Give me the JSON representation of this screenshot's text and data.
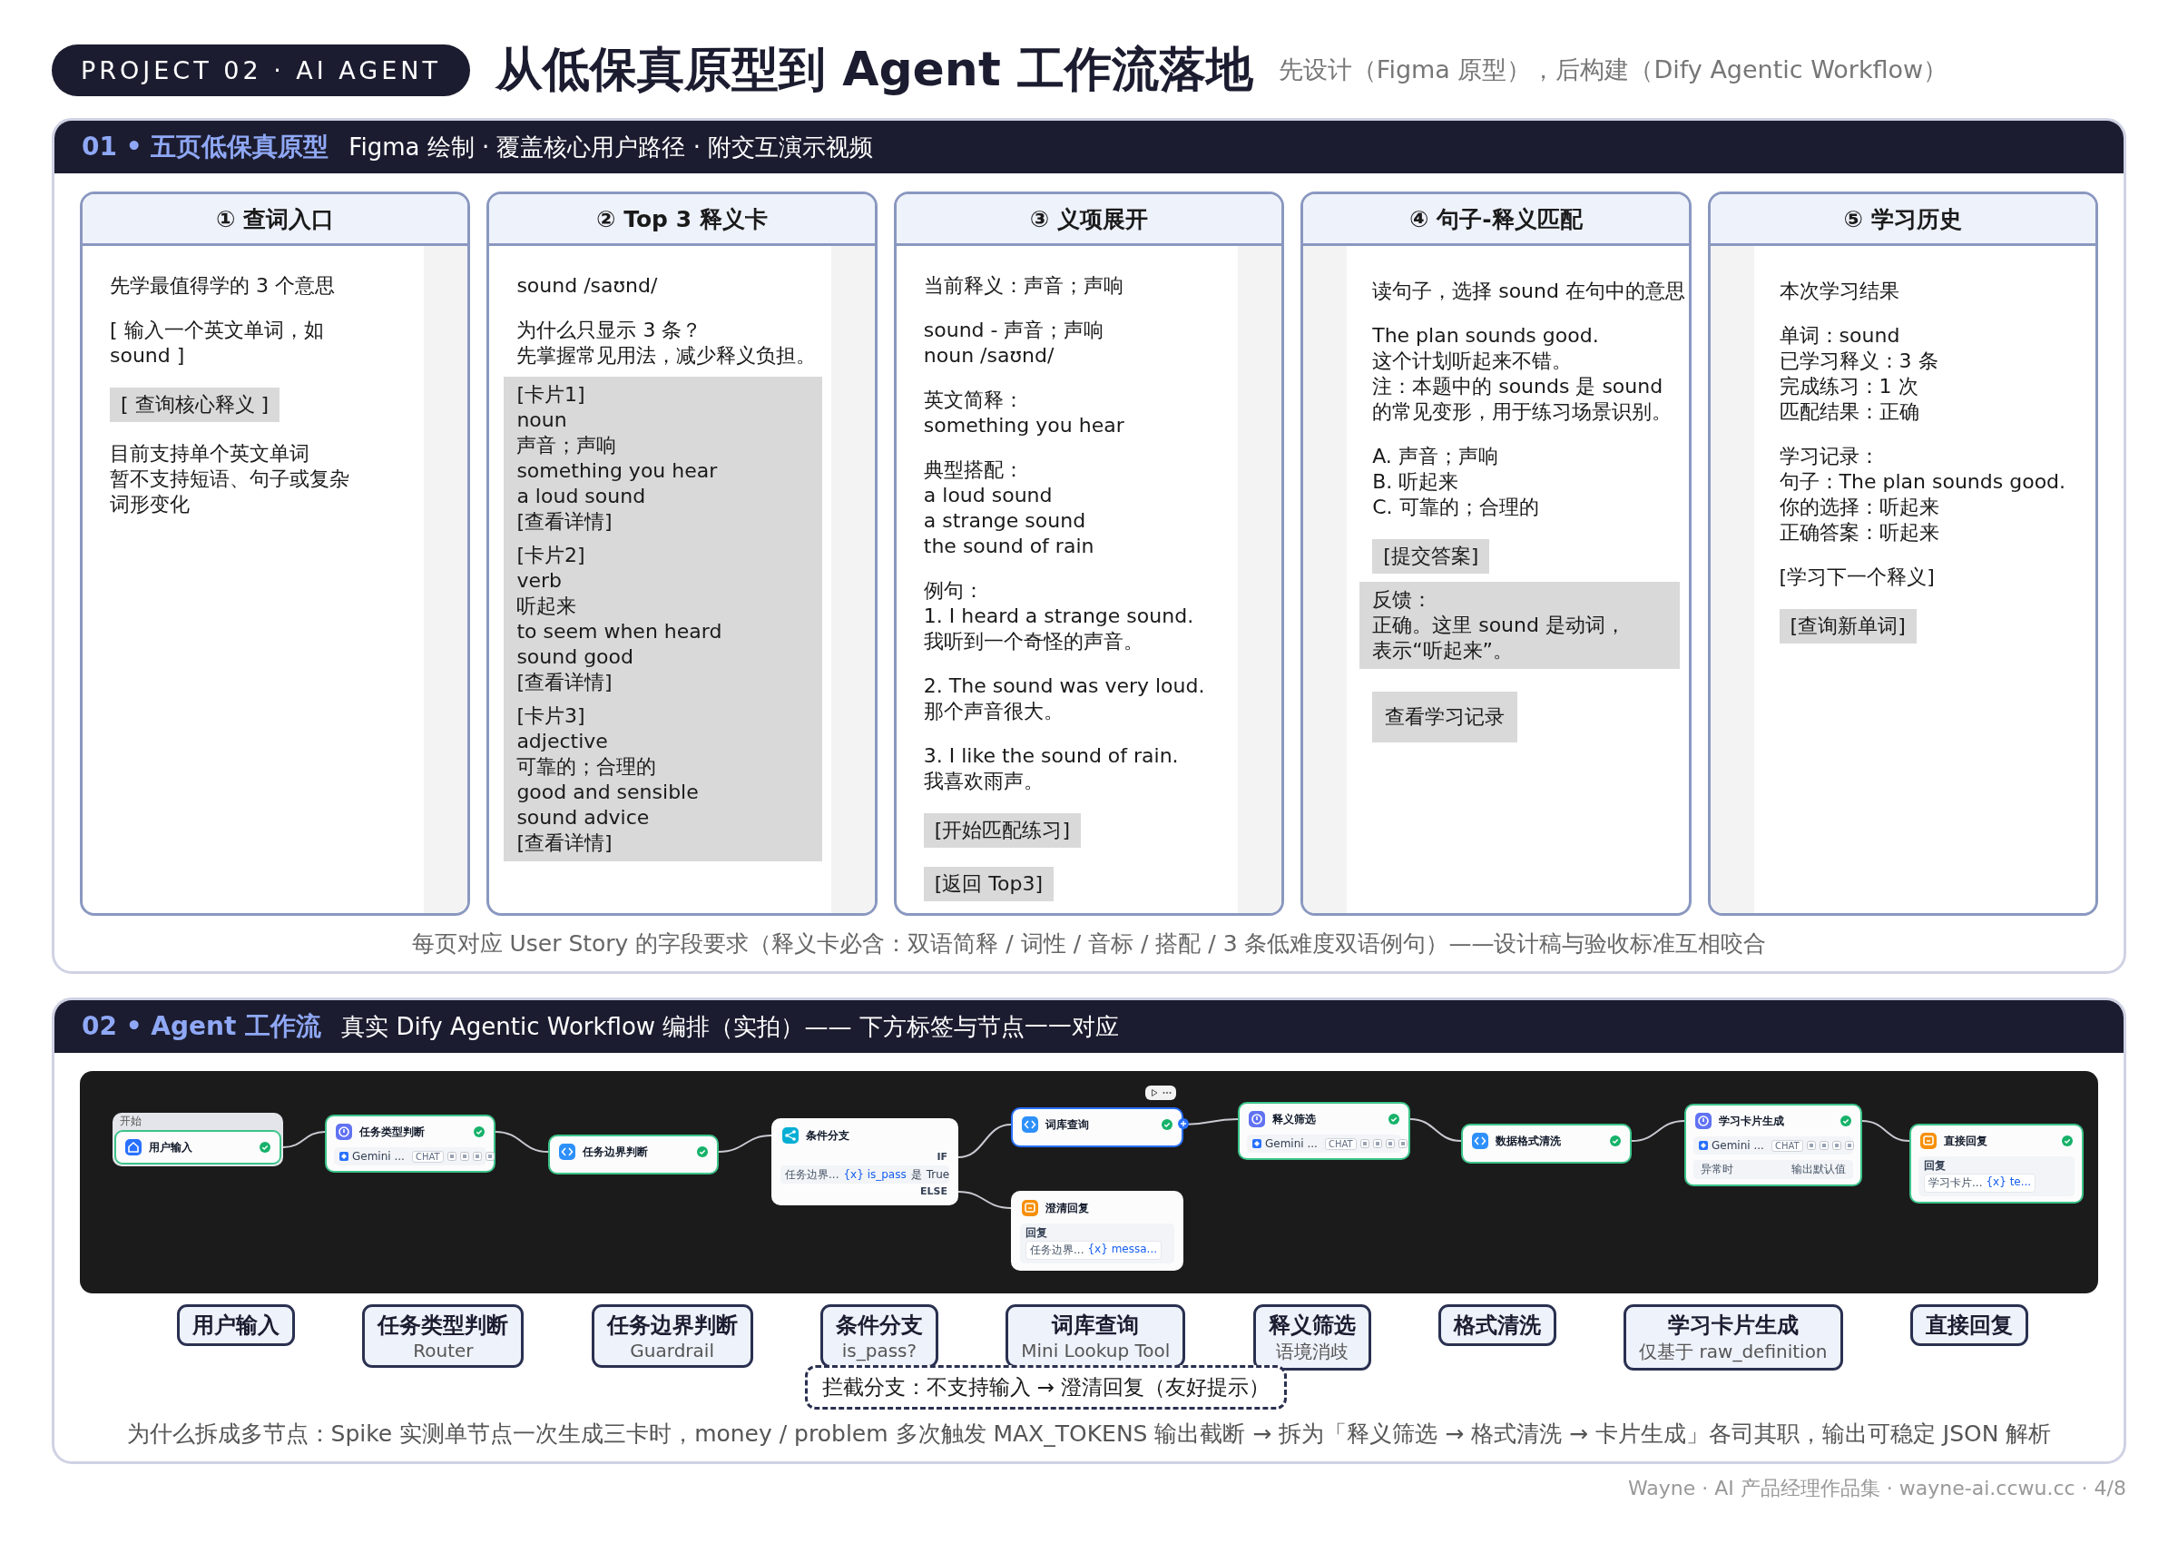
{
  "header": {
    "badge": "PROJECT 02 · AI AGENT",
    "title": "从低保真原型到 Agent 工作流落地",
    "subtitle": "先设计（Figma 原型），后构建（Dify Agentic Workflow）"
  },
  "prototype_section": {
    "heading": "01 • 五页低保真原型",
    "subtitle": "Figma 绘制 · 覆盖核心用户路径 · 附交互演示视频",
    "screens": [
      {
        "title": "① 查词入口",
        "blocks": [
          {
            "kind": "text",
            "lines": [
              "先学最值得学的 3 个意思"
            ]
          },
          {
            "kind": "text",
            "lines": [
              "[ 输入一个英文单词，如",
              "sound ]"
            ]
          },
          {
            "kind": "button",
            "text": "[ 查询核心释义 ]"
          },
          {
            "kind": "text",
            "lines": [
              "目前支持单个英文单词",
              "暂不支持短语、句子或复杂",
              "词形变化"
            ]
          }
        ]
      },
      {
        "title": "② Top 3 释义卡",
        "blocks": [
          {
            "kind": "text",
            "lines": [
              "sound /saʊnd/"
            ]
          },
          {
            "kind": "text",
            "lines": [
              "为什么只显示 3 条？",
              "先掌握常见用法，减少释义负担。"
            ]
          },
          {
            "kind": "card",
            "lines": [
              "[卡片1]",
              "noun",
              "声音；声响",
              "something you hear",
              "a loud sound",
              "[查看详情]"
            ]
          },
          {
            "kind": "card",
            "lines": [
              "[卡片2]",
              "verb",
              "听起来",
              "to seem when heard",
              "sound good",
              "[查看详情]"
            ]
          },
          {
            "kind": "card",
            "lines": [
              "[卡片3]",
              "adjective",
              "可靠的；合理的",
              "good and sensible",
              "sound advice",
              "[查看详情]"
            ]
          }
        ]
      },
      {
        "title": "③ 义项展开",
        "blocks": [
          {
            "kind": "text",
            "lines": [
              "当前释义：声音；声响"
            ]
          },
          {
            "kind": "text",
            "lines": [
              "sound - 声音；声响",
              "noun /saʊnd/"
            ]
          },
          {
            "kind": "text",
            "lines": [
              "英文简释：",
              "something you hear"
            ]
          },
          {
            "kind": "text",
            "lines": [
              "典型搭配：",
              "a loud sound",
              "a strange sound",
              "the sound of rain"
            ]
          },
          {
            "kind": "text",
            "lines": [
              "例句：",
              "1. I heard a strange sound.",
              "我听到一个奇怪的声音。"
            ]
          },
          {
            "kind": "text",
            "lines": [
              "2. The sound was very loud.",
              "那个声音很大。"
            ]
          },
          {
            "kind": "text",
            "lines": [
              "3. I like the sound of rain.",
              "我喜欢雨声。"
            ]
          },
          {
            "kind": "button",
            "text": "[开始匹配练习]"
          },
          {
            "kind": "button",
            "text": "[返回 Top3]"
          }
        ]
      },
      {
        "title": "④ 句子-释义匹配",
        "blocks": [
          {
            "kind": "text",
            "lines": [
              "读句子，选择 sound 在句中的意思"
            ]
          },
          {
            "kind": "text",
            "lines": [
              "The plan sounds good.",
              "这个计划听起来不错。",
              "注：本题中的 sounds 是 sound",
              "的常见变形，用于练习场景识别。"
            ]
          },
          {
            "kind": "text",
            "lines": [
              "A. 声音；声响",
              "B. 听起来",
              "C. 可靠的；合理的"
            ]
          },
          {
            "kind": "button",
            "text": "[提交答案]"
          },
          {
            "kind": "card",
            "lines": [
              "反馈：",
              "正确。这里 sound 是动词，",
              "表示“听起来”。"
            ]
          },
          {
            "kind": "bigbutton",
            "text": "查看学习记录"
          }
        ]
      },
      {
        "title": "⑤ 学习历史",
        "blocks": [
          {
            "kind": "text",
            "lines": [
              "本次学习结果"
            ]
          },
          {
            "kind": "text",
            "lines": [
              "单词：sound",
              "已学习释义：3 条",
              "完成练习：1 次",
              "匹配结果：正确"
            ]
          },
          {
            "kind": "text",
            "lines": [
              "学习记录：",
              "句子：The plan sounds good.",
              "你的选择：听起来",
              "正确答案：听起来"
            ]
          },
          {
            "kind": "text",
            "lines": [
              "[学习下一个释义]"
            ]
          },
          {
            "kind": "button",
            "text": "[查询新单词]"
          }
        ]
      }
    ],
    "note": "每页对应 User Story 的字段要求（释义卡必含：双语简释 / 词性 / 音标 / 搭配 / 3 条低难度双语例句）——设计稿与验收标准互相咬合"
  },
  "workflow_section": {
    "heading": "02 • Agent 工作流",
    "subtitle": "真实 Dify Agentic Workflow 编排（实拍）—— 下方标签与节点一一对应",
    "nodes": [
      {
        "kind": "start",
        "group_label": "开始",
        "title": "用户输入",
        "done": true,
        "selected": false
      },
      {
        "kind": "llm",
        "title": "任务类型判断",
        "model": "Gemini ...",
        "mode": "CHAT",
        "done": true,
        "selected": false
      },
      {
        "kind": "code",
        "title": "任务边界判断",
        "done": true,
        "selected": false
      },
      {
        "kind": "branch",
        "title": "条件分支",
        "if_label": "IF",
        "source": "任务边界...",
        "variable": "{x} is_pass",
        "operator": "是",
        "value": "True",
        "else_label": "ELSE",
        "done": false,
        "selected": false
      },
      {
        "kind": "code",
        "title": "词库查询",
        "done": true,
        "selected": true
      },
      {
        "kind": "reply",
        "title": "澄清回复",
        "reply_label": "回复",
        "source": "任务边界...",
        "variable": "{x} messa...",
        "done": false,
        "selected": false
      },
      {
        "kind": "llm",
        "title": "释义筛选",
        "model": "Gemini ...",
        "mode": "CHAT",
        "done": true,
        "selected": false
      },
      {
        "kind": "code",
        "title": "数据格式清洗",
        "done": true,
        "selected": false
      },
      {
        "kind": "llm",
        "title": "学习卡片生成",
        "model": "Gemini ...",
        "mode": "CHAT",
        "fallback_label": "异常时",
        "fallback_value": "输出默认值",
        "done": true,
        "selected": false
      },
      {
        "kind": "reply",
        "title": "直接回复",
        "reply_label": "回复",
        "source": "学习卡片...",
        "variable": "{x} te...",
        "done": true,
        "selected": false
      }
    ],
    "labels": [
      {
        "title": "用户输入"
      },
      {
        "title": "任务类型判断",
        "subtitle": "Router"
      },
      {
        "title": "任务边界判断",
        "subtitle": "Guardrail"
      },
      {
        "title": "条件分支",
        "subtitle": "is_pass?"
      },
      {
        "title": "词库查询",
        "subtitle": "Mini Lookup Tool"
      },
      {
        "title": "释义筛选",
        "subtitle": "语境消歧"
      },
      {
        "title": "格式清洗"
      },
      {
        "title": "学习卡片生成",
        "subtitle": "仅基于 raw_definition"
      },
      {
        "title": "直接回复"
      }
    ],
    "branch_note": "拦截分支：不支持输入 → 澄清回复（友好提示）",
    "why_note": "为什么拆成多节点：Spike 实测单节点一次生成三卡时，money / problem 多次触发 MAX_TOKENS 输出截断 → 拆为「释义筛选 → 格式清洗 → 卡片生成」各司其职，输出可稳定 JSON 解析"
  },
  "footer": "Wayne · AI 产品经理作品集 · wayne-ai.ccwu.cc · 4/8"
}
